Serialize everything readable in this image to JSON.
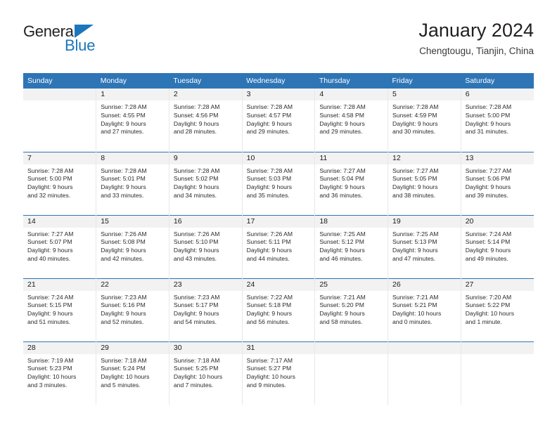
{
  "brand": {
    "name_top": "General",
    "name_bottom": "Blue",
    "triangle_color": "#1b76bc"
  },
  "header": {
    "title": "January 2024",
    "location": "Chengtougu, Tianjin, China"
  },
  "theme": {
    "header_blue": "#2e75b6",
    "daynum_bg": "#f2f2f2",
    "text": "#2b2b2b"
  },
  "weekday_headers": [
    "Sunday",
    "Monday",
    "Tuesday",
    "Wednesday",
    "Thursday",
    "Friday",
    "Saturday"
  ],
  "weeks": [
    [
      {
        "day": "",
        "lines": []
      },
      {
        "day": "1",
        "lines": [
          "Sunrise: 7:28 AM",
          "Sunset: 4:55 PM",
          "Daylight: 9 hours",
          "and 27 minutes."
        ]
      },
      {
        "day": "2",
        "lines": [
          "Sunrise: 7:28 AM",
          "Sunset: 4:56 PM",
          "Daylight: 9 hours",
          "and 28 minutes."
        ]
      },
      {
        "day": "3",
        "lines": [
          "Sunrise: 7:28 AM",
          "Sunset: 4:57 PM",
          "Daylight: 9 hours",
          "and 29 minutes."
        ]
      },
      {
        "day": "4",
        "lines": [
          "Sunrise: 7:28 AM",
          "Sunset: 4:58 PM",
          "Daylight: 9 hours",
          "and 29 minutes."
        ]
      },
      {
        "day": "5",
        "lines": [
          "Sunrise: 7:28 AM",
          "Sunset: 4:59 PM",
          "Daylight: 9 hours",
          "and 30 minutes."
        ]
      },
      {
        "day": "6",
        "lines": [
          "Sunrise: 7:28 AM",
          "Sunset: 5:00 PM",
          "Daylight: 9 hours",
          "and 31 minutes."
        ]
      }
    ],
    [
      {
        "day": "7",
        "lines": [
          "Sunrise: 7:28 AM",
          "Sunset: 5:00 PM",
          "Daylight: 9 hours",
          "and 32 minutes."
        ]
      },
      {
        "day": "8",
        "lines": [
          "Sunrise: 7:28 AM",
          "Sunset: 5:01 PM",
          "Daylight: 9 hours",
          "and 33 minutes."
        ]
      },
      {
        "day": "9",
        "lines": [
          "Sunrise: 7:28 AM",
          "Sunset: 5:02 PM",
          "Daylight: 9 hours",
          "and 34 minutes."
        ]
      },
      {
        "day": "10",
        "lines": [
          "Sunrise: 7:28 AM",
          "Sunset: 5:03 PM",
          "Daylight: 9 hours",
          "and 35 minutes."
        ]
      },
      {
        "day": "11",
        "lines": [
          "Sunrise: 7:27 AM",
          "Sunset: 5:04 PM",
          "Daylight: 9 hours",
          "and 36 minutes."
        ]
      },
      {
        "day": "12",
        "lines": [
          "Sunrise: 7:27 AM",
          "Sunset: 5:05 PM",
          "Daylight: 9 hours",
          "and 38 minutes."
        ]
      },
      {
        "day": "13",
        "lines": [
          "Sunrise: 7:27 AM",
          "Sunset: 5:06 PM",
          "Daylight: 9 hours",
          "and 39 minutes."
        ]
      }
    ],
    [
      {
        "day": "14",
        "lines": [
          "Sunrise: 7:27 AM",
          "Sunset: 5:07 PM",
          "Daylight: 9 hours",
          "and 40 minutes."
        ]
      },
      {
        "day": "15",
        "lines": [
          "Sunrise: 7:26 AM",
          "Sunset: 5:08 PM",
          "Daylight: 9 hours",
          "and 42 minutes."
        ]
      },
      {
        "day": "16",
        "lines": [
          "Sunrise: 7:26 AM",
          "Sunset: 5:10 PM",
          "Daylight: 9 hours",
          "and 43 minutes."
        ]
      },
      {
        "day": "17",
        "lines": [
          "Sunrise: 7:26 AM",
          "Sunset: 5:11 PM",
          "Daylight: 9 hours",
          "and 44 minutes."
        ]
      },
      {
        "day": "18",
        "lines": [
          "Sunrise: 7:25 AM",
          "Sunset: 5:12 PM",
          "Daylight: 9 hours",
          "and 46 minutes."
        ]
      },
      {
        "day": "19",
        "lines": [
          "Sunrise: 7:25 AM",
          "Sunset: 5:13 PM",
          "Daylight: 9 hours",
          "and 47 minutes."
        ]
      },
      {
        "day": "20",
        "lines": [
          "Sunrise: 7:24 AM",
          "Sunset: 5:14 PM",
          "Daylight: 9 hours",
          "and 49 minutes."
        ]
      }
    ],
    [
      {
        "day": "21",
        "lines": [
          "Sunrise: 7:24 AM",
          "Sunset: 5:15 PM",
          "Daylight: 9 hours",
          "and 51 minutes."
        ]
      },
      {
        "day": "22",
        "lines": [
          "Sunrise: 7:23 AM",
          "Sunset: 5:16 PM",
          "Daylight: 9 hours",
          "and 52 minutes."
        ]
      },
      {
        "day": "23",
        "lines": [
          "Sunrise: 7:23 AM",
          "Sunset: 5:17 PM",
          "Daylight: 9 hours",
          "and 54 minutes."
        ]
      },
      {
        "day": "24",
        "lines": [
          "Sunrise: 7:22 AM",
          "Sunset: 5:18 PM",
          "Daylight: 9 hours",
          "and 56 minutes."
        ]
      },
      {
        "day": "25",
        "lines": [
          "Sunrise: 7:21 AM",
          "Sunset: 5:20 PM",
          "Daylight: 9 hours",
          "and 58 minutes."
        ]
      },
      {
        "day": "26",
        "lines": [
          "Sunrise: 7:21 AM",
          "Sunset: 5:21 PM",
          "Daylight: 10 hours",
          "and 0 minutes."
        ]
      },
      {
        "day": "27",
        "lines": [
          "Sunrise: 7:20 AM",
          "Sunset: 5:22 PM",
          "Daylight: 10 hours",
          "and 1 minute."
        ]
      }
    ],
    [
      {
        "day": "28",
        "lines": [
          "Sunrise: 7:19 AM",
          "Sunset: 5:23 PM",
          "Daylight: 10 hours",
          "and 3 minutes."
        ]
      },
      {
        "day": "29",
        "lines": [
          "Sunrise: 7:18 AM",
          "Sunset: 5:24 PM",
          "Daylight: 10 hours",
          "and 5 minutes."
        ]
      },
      {
        "day": "30",
        "lines": [
          "Sunrise: 7:18 AM",
          "Sunset: 5:25 PM",
          "Daylight: 10 hours",
          "and 7 minutes."
        ]
      },
      {
        "day": "31",
        "lines": [
          "Sunrise: 7:17 AM",
          "Sunset: 5:27 PM",
          "Daylight: 10 hours",
          "and 9 minutes."
        ]
      },
      {
        "day": "",
        "lines": []
      },
      {
        "day": "",
        "lines": []
      },
      {
        "day": "",
        "lines": []
      }
    ]
  ]
}
